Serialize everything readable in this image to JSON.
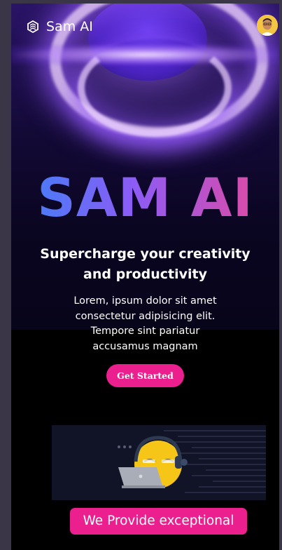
{
  "navbar": {
    "logo_icon": "hexagon-stack-icon",
    "brand": "Sam AI",
    "avatar_icon": "user-avatar"
  },
  "hero": {
    "title": "SAM AI",
    "subtitle": "Supercharge your creativity and productivity",
    "description": "Lorem, ipsum dolor sit amet consectetur adipisicing elit. Tempore sint pariatur accusamus magnam",
    "cta_label": "Get Started",
    "title_gradient": [
      "#3b82f6",
      "#8b5cf6",
      "#ec4899"
    ]
  },
  "illustration": {
    "icon": "emoji-with-headphones-and-laptop"
  },
  "banner": {
    "text": "We Provide exceptional"
  },
  "colors": {
    "accent": "#ec1f8f",
    "page_background": "#000000",
    "outer_background": "#3b3647"
  }
}
